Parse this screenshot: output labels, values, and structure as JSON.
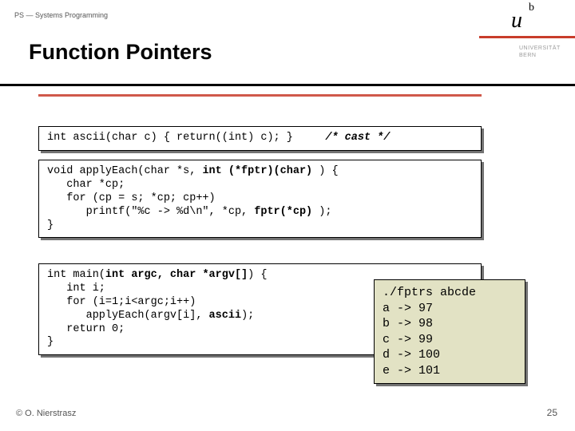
{
  "header": {
    "course": "PS — Systems Programming",
    "title": "Function Pointers",
    "univ_line1": "UNIVERSITÄT",
    "univ_line2": "BERN",
    "logo_u": "u",
    "logo_b": "b"
  },
  "code": {
    "line1_a": "int ascii(char c) { return((int) c); }     ",
    "line1_b": "/* cast */",
    "line2_a": "void applyEach(char *s, ",
    "line2_b": "int (*fptr)(char)",
    "line2_c": " ) {",
    "line3": "   char *cp;",
    "line4": "   for (cp = s; *cp; cp++)",
    "line5_a": "      printf(\"%c -> %d\\n\", *cp, ",
    "line5_b": "fptr(*cp)",
    "line5_c": " );",
    "line6": "}",
    "line7_a": "int main(",
    "line7_b": "int argc, char *argv[]",
    "line7_c": ") {",
    "line8": "   int i;",
    "line9": "   for (i=1;i<argc;i++)",
    "line10_a": "      applyEach(argv[i], ",
    "line10_b": "ascii",
    "line10_c": ");",
    "line11": "   return 0;",
    "line12": "}"
  },
  "output": {
    "cmd": "./fptrs abcde",
    "r1": "a -> 97",
    "r2": "b -> 98",
    "r3": "c -> 99",
    "r4": "d -> 100",
    "r5": "e -> 101"
  },
  "footer": {
    "copyright": "© O. Nierstrasz",
    "page": "25"
  }
}
